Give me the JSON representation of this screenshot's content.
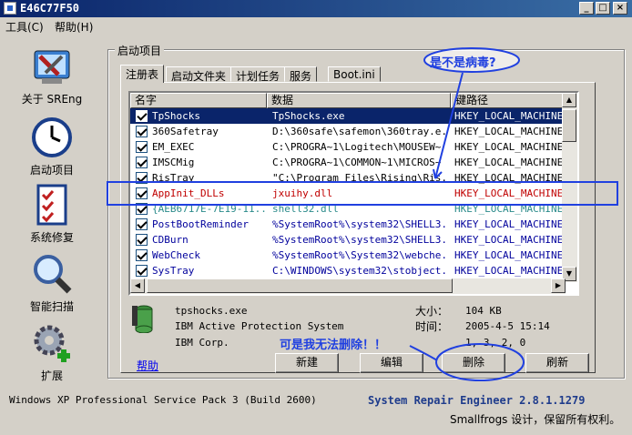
{
  "window": {
    "title": "E46C77F50"
  },
  "menu": {
    "items": [
      "工具(C)",
      "帮助(H)"
    ]
  },
  "nav": [
    {
      "label": "关于 SREng",
      "icon": "tools-icon"
    },
    {
      "label": "启动项目",
      "icon": "clock-icon"
    },
    {
      "label": "系统修复",
      "icon": "checklist-icon"
    },
    {
      "label": "智能扫描",
      "icon": "magnifier-icon"
    },
    {
      "label": "扩展",
      "icon": "gear-plus-icon"
    }
  ],
  "group": {
    "title": "启动项目"
  },
  "tabs": [
    "注册表",
    "启动文件夹",
    "计划任务",
    "服务",
    "Boot.ini"
  ],
  "list": {
    "columns": [
      "名字",
      "数据",
      "键路径"
    ],
    "rows": [
      {
        "name": "TpShocks",
        "data": "TpShocks.exe",
        "path": "HKEY_LOCAL_MACHINE\\Sof",
        "selected": true
      },
      {
        "name": "360Safetray",
        "data": "D:\\360safe\\safemon\\360tray.e...",
        "path": "HKEY_LOCAL_MACHINE\\Sof"
      },
      {
        "name": "EM_EXEC",
        "data": "C:\\PROGRA~1\\Logitech\\MOUSEW~",
        "path": "HKEY_LOCAL_MACHINE\\Sof"
      },
      {
        "name": "IMSCMig",
        "data": "C:\\PROGRA~1\\COMMON~1\\MICROS~",
        "path": "HKEY_LOCAL_MACHINE\\Sof"
      },
      {
        "name": "RisTray",
        "data": "\"C:\\Program Files\\Rising\\Ris...",
        "path": "HKEY_LOCAL_MACHINE\\Sof"
      },
      {
        "name": "AppInit_DLLs",
        "data": "jxuihy.dll",
        "path": "HKEY_LOCAL_MACHINE\\Sof",
        "color": "#c00000"
      },
      {
        "name": "{AEB6717E-7E19-11...",
        "data": "shell32.dll",
        "path": "HKEY_LOCAL_MACHINE\\SOF",
        "color": "#2a8a8a"
      },
      {
        "name": "PostBootReminder",
        "data": "%SystemRoot%\\system32\\SHELL3...",
        "path": "HKEY_LOCAL_MACHINE\\SOF",
        "color": "#00009c"
      },
      {
        "name": "CDBurn",
        "data": "%SystemRoot%\\system32\\SHELL3...",
        "path": "HKEY_LOCAL_MACHINE\\SOF",
        "color": "#00009c"
      },
      {
        "name": "WebCheck",
        "data": "%SystemRoot%\\System32\\webche...",
        "path": "HKEY_LOCAL_MACHINE\\SOF",
        "color": "#00009c"
      },
      {
        "name": "SysTray",
        "data": "C:\\WINDOWS\\system32\\stobject...",
        "path": "HKEY_LOCAL_MACHINE\\SOF",
        "color": "#00009c"
      }
    ]
  },
  "details": {
    "file": "tpshocks.exe",
    "company_product": "IBM Active Protection System",
    "company": "IBM Corp.",
    "size_label": "大小：",
    "size_value": "104 KB",
    "time_label": "时间：",
    "time_value": "2005-4-5 15:14",
    "version_value": "1, 3, 2, 0"
  },
  "buttons": {
    "help": "帮助",
    "new": "新建",
    "edit": "编辑",
    "delete": "删除",
    "refresh": "刷新"
  },
  "status": {
    "os": "Windows XP Professional Service Pack 3 (Build 2600)",
    "brand": "System Repair Engineer 2.8.1.1279",
    "credit": "Smallfrogs 设计，保留所有权利。"
  },
  "annotations": {
    "question": "是不是病毒?",
    "cannot_delete": "可是我无法删除！！"
  },
  "colors": {
    "annotation": "#2040e0",
    "selection": "#0a246a"
  }
}
